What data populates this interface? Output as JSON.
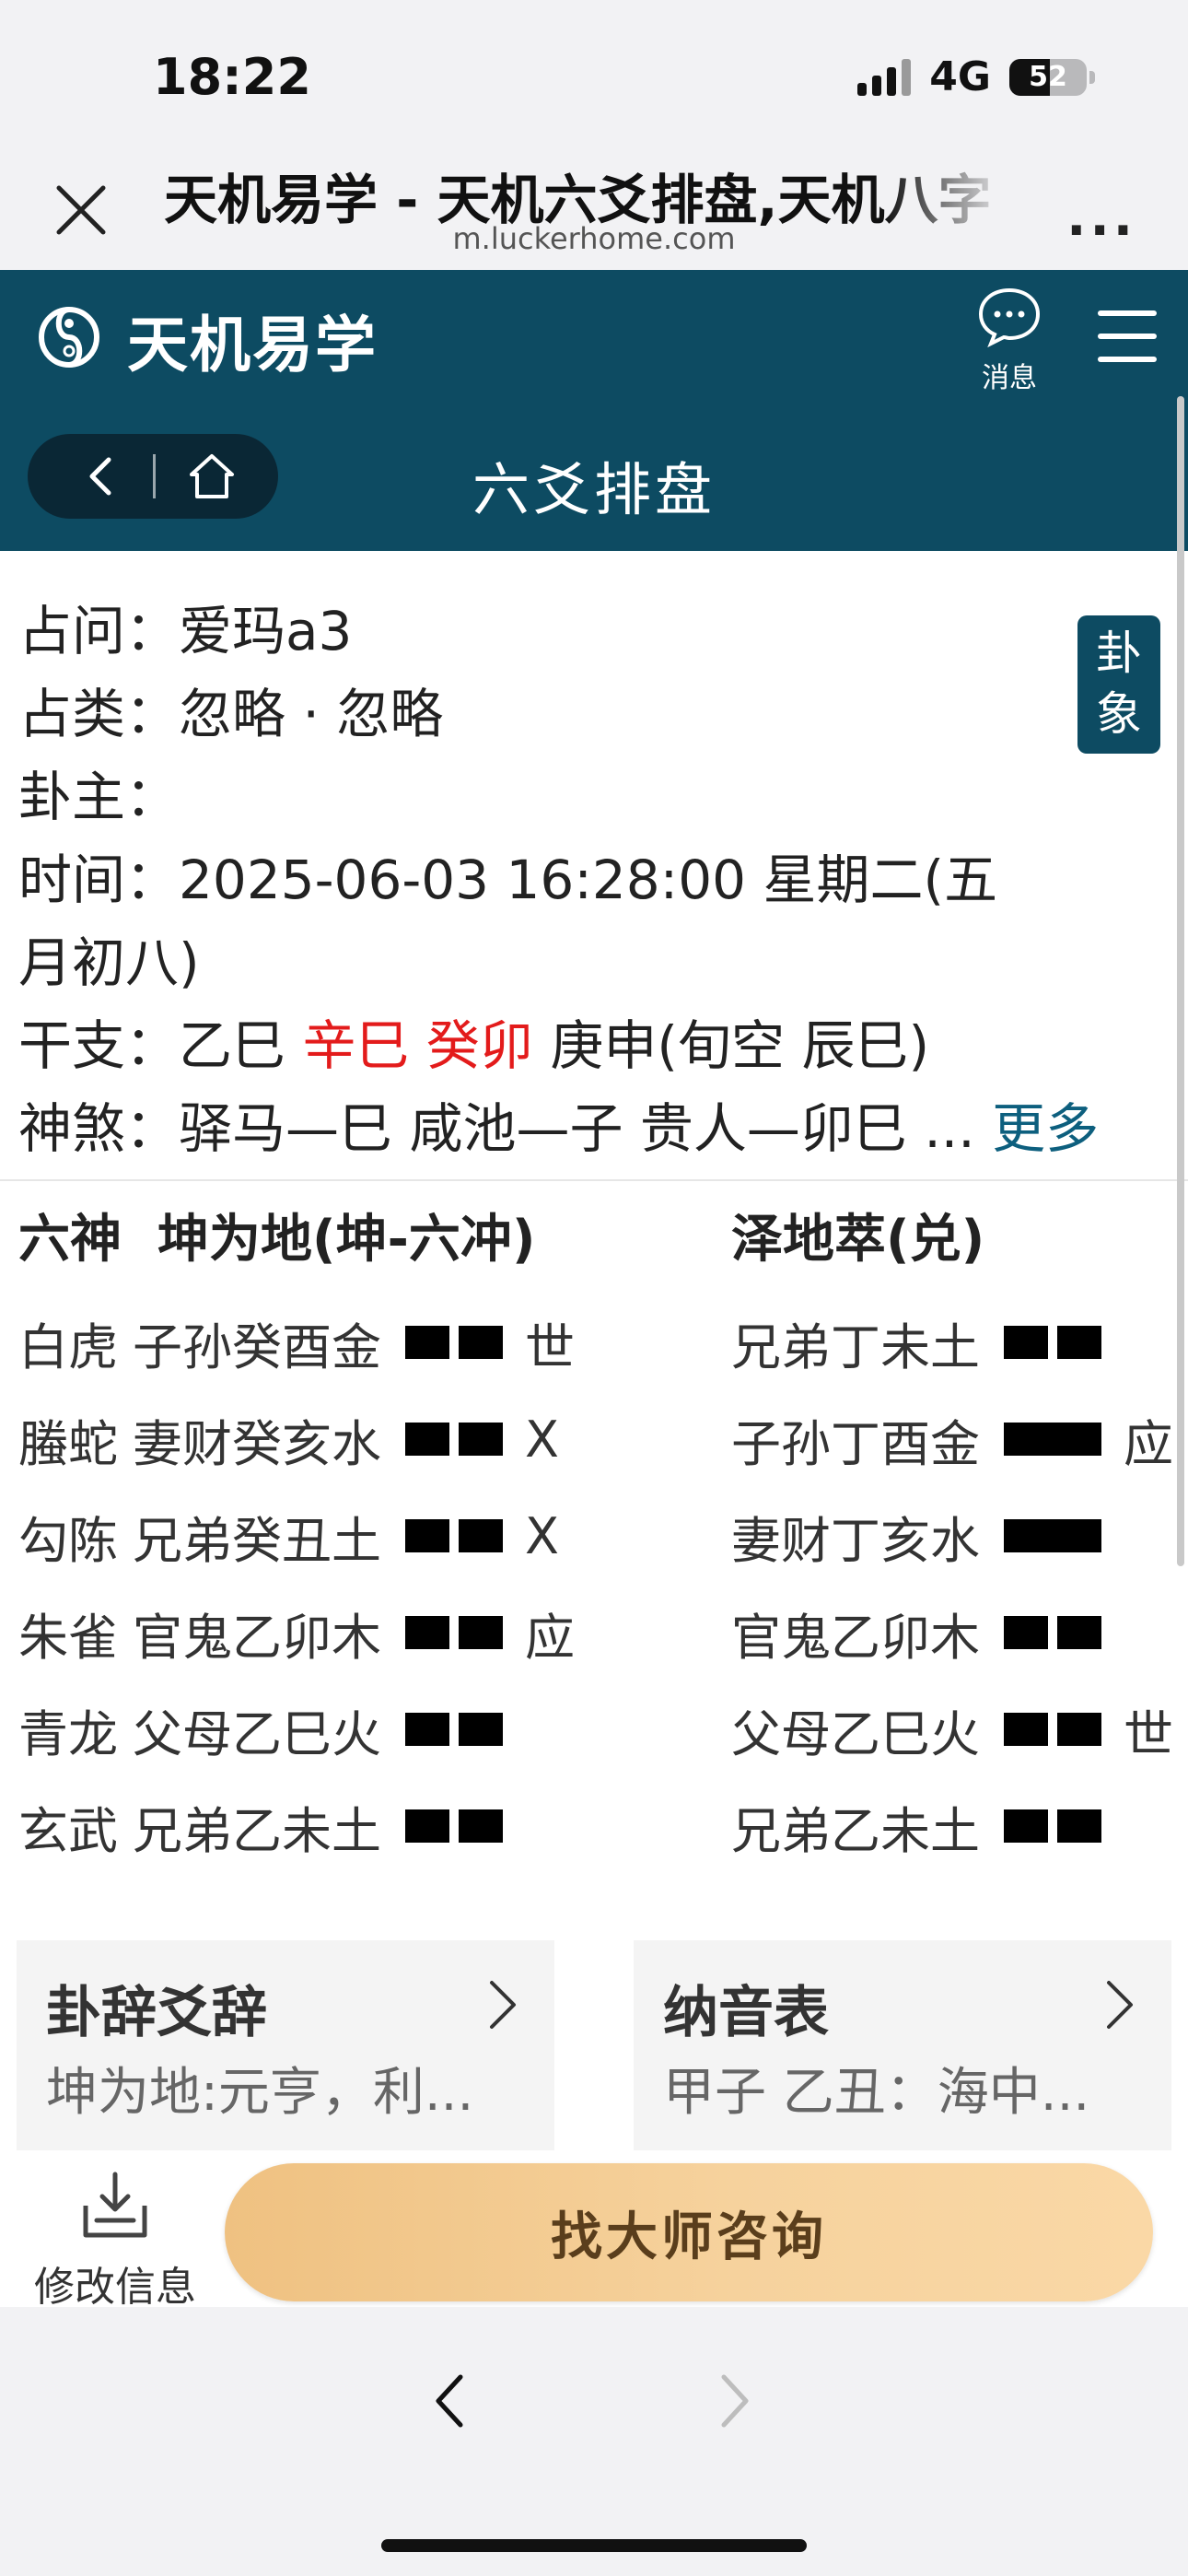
{
  "status_bar": {
    "time": "18:22",
    "network": "4G",
    "battery": "52"
  },
  "browser": {
    "page_title": "天机易学 - 天机六爻排盘,天机八字",
    "url": "m.luckerhome.com",
    "more": "..."
  },
  "header": {
    "site_name": "天机易学",
    "message_label": "消息",
    "sub_title": "六爻排盘",
    "brand_color": "#0d4b62"
  },
  "info": {
    "question_label": "占问：",
    "question": "爱玛a3",
    "category_label": "占类：",
    "category": "忽略 · 忽略",
    "owner_label": "卦主：",
    "owner": "",
    "time_label": "时间：",
    "time": "2025-06-03 16:28:00   星期二(五",
    "time_cont": "月初八)",
    "ganzhi_label": "干支：",
    "ganzhi_1": "乙巳",
    "ganzhi_2": "辛巳",
    "ganzhi_3": "癸卯",
    "ganzhi_4": "庚申",
    "ganzhi_xunkong": "(旬空   辰巳)",
    "shensha_label": "神煞：",
    "shensha": "驿马—巳 咸池—子 贵人—卯巳 ...",
    "more_link": "更多",
    "badge_1": "卦",
    "badge_2": "象"
  },
  "hexagram": {
    "liushen_header": "六神",
    "main_name": "坤为地(坤-六冲)",
    "changed_name": "泽地萃(兑)",
    "main_lines": [
      {
        "shen": "白虎",
        "text": "子孙癸酉金",
        "yang": false,
        "mark": "世"
      },
      {
        "shen": "螣蛇",
        "text": "妻财癸亥水",
        "yang": false,
        "mark": "X"
      },
      {
        "shen": "勾陈",
        "text": "兄弟癸丑土",
        "yang": false,
        "mark": "X"
      },
      {
        "shen": "朱雀",
        "text": "官鬼乙卯木",
        "yang": false,
        "mark": "应"
      },
      {
        "shen": "青龙",
        "text": "父母乙巳火",
        "yang": false,
        "mark": ""
      },
      {
        "shen": "玄武",
        "text": "兄弟乙未土",
        "yang": false,
        "mark": ""
      }
    ],
    "changed_lines": [
      {
        "text": "兄弟丁未土",
        "yang": false,
        "mark": ""
      },
      {
        "text": "子孙丁酉金",
        "yang": true,
        "mark": "应"
      },
      {
        "text": "妻财丁亥水",
        "yang": true,
        "mark": ""
      },
      {
        "text": "官鬼乙卯木",
        "yang": false,
        "mark": ""
      },
      {
        "text": "父母乙巳火",
        "yang": false,
        "mark": "世"
      },
      {
        "text": "兄弟乙未土",
        "yang": false,
        "mark": ""
      }
    ]
  },
  "cards": {
    "guaci_title": "卦辞爻辞",
    "guaci_desc": "坤为地:元亨，利...",
    "nayin_title": "纳音表",
    "nayin_desc": "甲子 乙丑：海中..."
  },
  "actions": {
    "edit_label": "修改信息",
    "consult_label": "找大师咨询"
  }
}
